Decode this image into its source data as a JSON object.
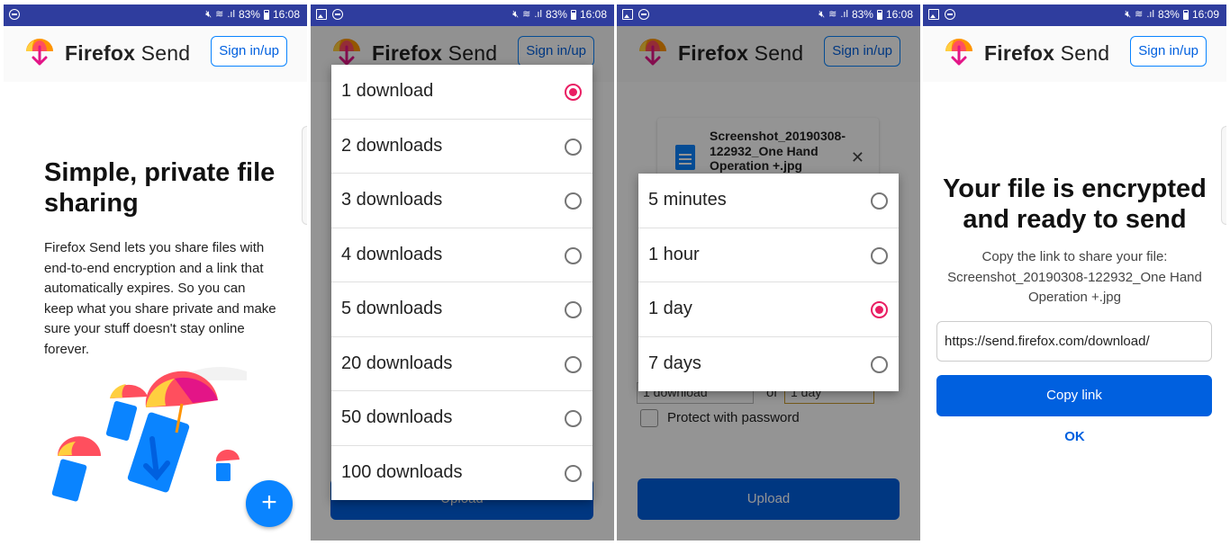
{
  "brand": {
    "name_bold": "Firefox",
    "name_rest": " Send",
    "signin_label": "Sign in/up"
  },
  "colors": {
    "status_bar": "#2f3d9e",
    "accent_blue": "#0a84ff",
    "button_blue": "#0060df",
    "radio_selected": "#e91e63"
  },
  "panels": [
    {
      "status": {
        "battery": "83%",
        "time": "16:08"
      },
      "title": "Simple, private file sharing",
      "body": "Firefox Send lets you share files with end-to-end encryption and a link that automatically expires. So you can keep what you share private and make sure your stuff doesn't stay online forever.",
      "fab_label": "+"
    },
    {
      "status": {
        "battery": "83%",
        "time": "16:08"
      },
      "dialog_options": [
        {
          "label": "1 download",
          "selected": true
        },
        {
          "label": "2 downloads",
          "selected": false
        },
        {
          "label": "3 downloads",
          "selected": false
        },
        {
          "label": "4 downloads",
          "selected": false
        },
        {
          "label": "5 downloads",
          "selected": false
        },
        {
          "label": "20 downloads",
          "selected": false
        },
        {
          "label": "50 downloads",
          "selected": false
        },
        {
          "label": "100 downloads",
          "selected": false
        }
      ],
      "upload_label": "Upload"
    },
    {
      "status": {
        "battery": "83%",
        "time": "16:08"
      },
      "file_name": "Screenshot_20190308-122932_One Hand Operation +.jpg",
      "dialog_options": [
        {
          "label": "5 minutes",
          "selected": false
        },
        {
          "label": "1 hour",
          "selected": false
        },
        {
          "label": "1 day",
          "selected": true
        },
        {
          "label": "7 days",
          "selected": false
        }
      ],
      "downloads_select": "1 download",
      "or_label": "or",
      "time_select": "1 day",
      "password_label": "Protect with password",
      "upload_label": "Upload"
    },
    {
      "status": {
        "battery": "83%",
        "time": "16:09"
      },
      "title": "Your file is encrypted and ready to send",
      "copy_prompt": "Copy the link to share your file:",
      "file_name": "Screenshot_20190308-122932_One Hand Operation +.jpg",
      "link_value": "https://send.firefox.com/download/",
      "copy_label": "Copy link",
      "ok_label": "OK"
    }
  ]
}
